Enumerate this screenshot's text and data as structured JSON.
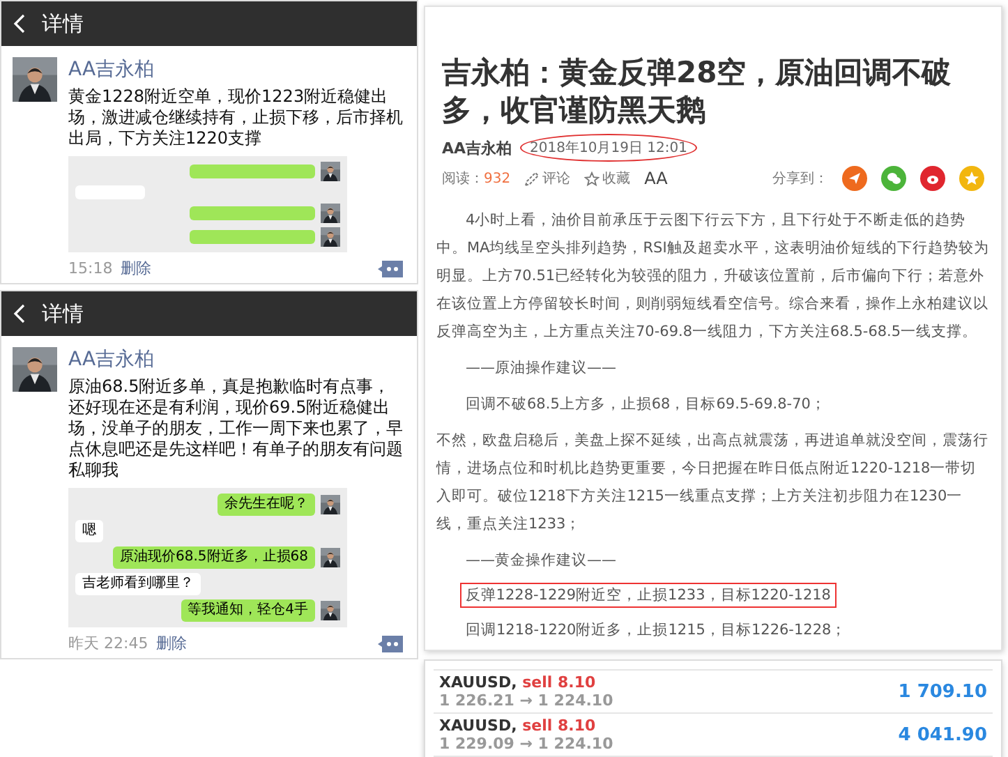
{
  "posts": [
    {
      "title": "详情",
      "author": "AA吉永柏",
      "text": "黄金1228附近空单，现价1223附近稳健出场，激进减仓继续持有，止损下移，后市择机出局，下方关注1220支撑",
      "thumbnail": {
        "kind": "chat",
        "messages": [
          {
            "kind": "sent"
          },
          {
            "kind": "received"
          },
          {
            "kind": "sent"
          },
          {
            "kind": "sent"
          }
        ]
      },
      "time": "15:18",
      "delete": "删除"
    },
    {
      "title": "详情",
      "author": "AA吉永柏",
      "text": "原油68.5附近多单，真是抱歉临时有点事，还好现在还是有利润，现价69.5附近稳健出场，没单子的朋友，工作一周下来也累了，早点休息吧还是先这样吧！有单子的朋友有问题私聊我",
      "thumbnail": {
        "kind": "chat",
        "messages": [
          {
            "kind": "sent",
            "text": "余先生在呢？"
          },
          {
            "kind": "received",
            "text": "嗯"
          },
          {
            "kind": "sent",
            "text": "原油现价68.5附近多，止损68"
          },
          {
            "kind": "received",
            "text": "吉老师看到哪里？"
          },
          {
            "kind": "sent",
            "text": "等我通知，轻仓4手"
          }
        ]
      },
      "time": "昨天 22:45",
      "delete": "删除"
    }
  ],
  "article": {
    "title": "吉永柏：黄金反弹28空，原油回调不破多，收官谨防黑天鹅",
    "author": "AA吉永柏",
    "date": "2018年10月19日 12:01",
    "date_circled": true,
    "reads_label": "阅读：",
    "reads": "932",
    "actions": [
      {
        "kind": "comment",
        "label": "评论"
      },
      {
        "kind": "favorite",
        "label": "收藏"
      }
    ],
    "font_button": "AA",
    "share_label": "分享到：",
    "share": [
      {
        "kind": "plane",
        "color": "#ee6a1e"
      },
      {
        "kind": "wechat",
        "color": "#4cb43a"
      },
      {
        "kind": "weibo",
        "color": "#e0262e"
      },
      {
        "kind": "star",
        "color": "#f2b60f"
      }
    ],
    "paragraphs": [
      {
        "kind": "indent",
        "text": "4小时上看，油价目前承压于云图下行云下方，且下行处于不断走低的趋势中。MA均线呈空头排列趋势，RSI触及超卖水平，这表明油价短线的下行趋势较为明显。上方70.51已经转化为较强的阻力，升破该位置前，后市偏向下行；若意外在该位置上方停留较长时间，则削弱短线看空信号。综合来看，操作上永柏建议以反弹高空为主，上方重点关注70-69.8一线阻力，下方关注68.5-68.5一线支撑。"
      },
      {
        "kind": "heading",
        "text": "——原油操作建议——"
      },
      {
        "kind": "indent",
        "text": "回调不破68.5上方多，止损68，目标69.5-69.8-70；"
      },
      {
        "kind": "plain",
        "text": "不然，欧盘启稳后，美盘上探不延续，出高点就震荡，再进追单就没空间，震荡行情，进场点位和时机比趋势更重要，今日把握在昨日低点附近1220-1218一带切入即可。破位1218下方关注1215一线重点支撑；上方关注初步阻力在1230一线，重点关注1233；"
      },
      {
        "kind": "heading",
        "text": "——黄金操作建议——"
      },
      {
        "kind": "highlight",
        "text": "反弹1228-1229附近空，止损1233，目标1220-1218"
      },
      {
        "kind": "indent",
        "text": "回调1218-1220附近多，止损1215，目标1226-1228；"
      }
    ]
  },
  "trades": [
    {
      "symbol": "XAUUSD,",
      "order": "sell 8.10",
      "prices": "1 226.21 → 1 224.10",
      "profit": "1 709.10"
    },
    {
      "symbol": "XAUUSD,",
      "order": "sell 8.10",
      "prices": "1 229.09 → 1 224.10",
      "profit": "4 041.90"
    }
  ]
}
